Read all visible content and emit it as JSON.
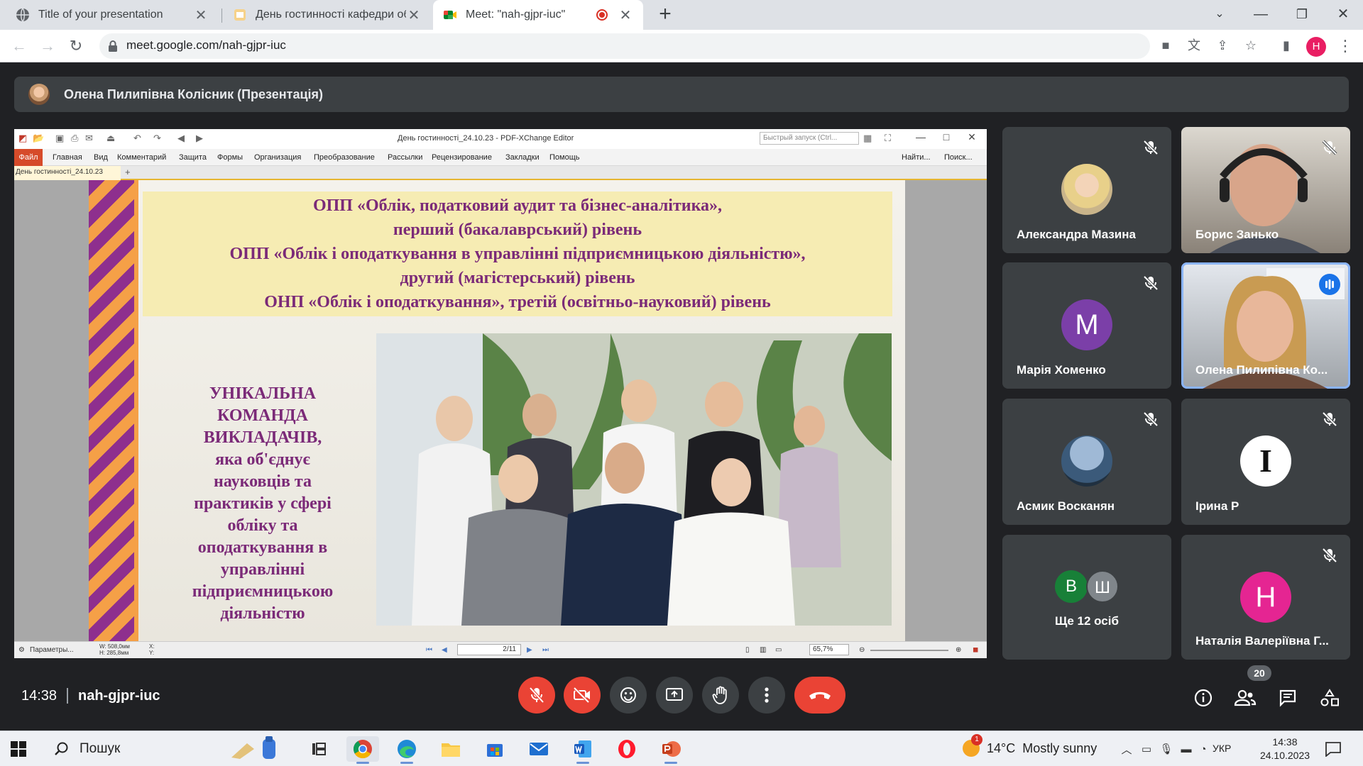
{
  "browser": {
    "tabs": [
      {
        "title": "Title of your presentation",
        "favicon": "globe-icon"
      },
      {
        "title": "День гостинності кафедри обл",
        "favicon": "slides-icon"
      },
      {
        "title": "Meet: \"nah-gjpr-iuc\"",
        "favicon": "meet-icon",
        "active": true,
        "recording": true
      }
    ],
    "url": "meet.google.com/nah-gjpr-iuc",
    "profile_initial": "H",
    "accent": "#1a73e8"
  },
  "meet": {
    "presenter_banner": "Олена Пилипівна Колісник (Презентація)",
    "time": "14:38",
    "meeting_code": "nah-gjpr-iuc",
    "participants_count": "20",
    "participants": [
      {
        "name": "Александра Мазина",
        "muted": true,
        "kind": "photo"
      },
      {
        "name": "Борис Занько",
        "muted": true,
        "kind": "video"
      },
      {
        "name": "Марія Хоменко",
        "muted": true,
        "kind": "letter",
        "letter": "M",
        "color": "#7b3fa8"
      },
      {
        "name": "Олена Пилипівна Ко...",
        "muted": false,
        "kind": "video",
        "speaking": true
      },
      {
        "name": "Асмик Восканян",
        "muted": true,
        "kind": "photo"
      },
      {
        "name": "Ірина Р",
        "muted": true,
        "kind": "letter",
        "letter": "I",
        "color": "#ffffff"
      },
      {
        "name": "Ще 12 осіб",
        "muted": false,
        "kind": "more",
        "letters": [
          "B",
          "Ш"
        ]
      },
      {
        "name": "Наталія Валеріївна Г...",
        "muted": true,
        "kind": "letter",
        "letter": "H",
        "color": "#e52592"
      }
    ]
  },
  "pdf_editor": {
    "window_title": "День гостинності_24.10.23 - PDF-XChange Editor",
    "quick_launch_placeholder": "Быстрый запуск (Ctrl...",
    "menu": [
      "Файл",
      "Главная",
      "Вид",
      "Комментарий",
      "Защита",
      "Формы",
      "Организация",
      "Преобразование",
      "Рассылки",
      "Рецензирование",
      "Закладки",
      "Помощь"
    ],
    "find": "Найти...",
    "search": "Поиск...",
    "doc_tab": "День гостинності_24.10.23",
    "status_params": "Параметры...",
    "status_w": "W: 508,0мм",
    "status_h": "H: 285,8мм",
    "status_x": "X:",
    "status_y": "Y:",
    "page": "2/11",
    "zoom": "65,7%"
  },
  "slide": {
    "header_lines": [
      "ОПП «Облік, податковий аудит та бізнес-аналітика»,",
      "перший (бакалаврський) рівень",
      "ОПП «Облік і оподаткування в управлінні підприємницькою діяльністю»,",
      "другий (магістерський) рівень",
      "ОНП «Облік і оподаткування», третій (освітньо-науковий) рівень"
    ],
    "left_text": [
      "УНІКАЛЬНА",
      "КОМАНДА",
      "ВИКЛАДАЧІВ,",
      "яка об'єднує",
      "науковців та",
      "практиків у сфері",
      "обліку та",
      "оподаткування в",
      "управлінні",
      "підприємницькою",
      "діяльністю"
    ],
    "accent_purple": "#7b2a78",
    "accent_orange": "#f5a047"
  },
  "taskbar": {
    "search": "Пошук",
    "weather_temp": "14°C",
    "weather_text": "Mostly sunny",
    "weather_badge": "1",
    "lang": "УКР",
    "time": "14:38",
    "date": "24.10.2023"
  }
}
